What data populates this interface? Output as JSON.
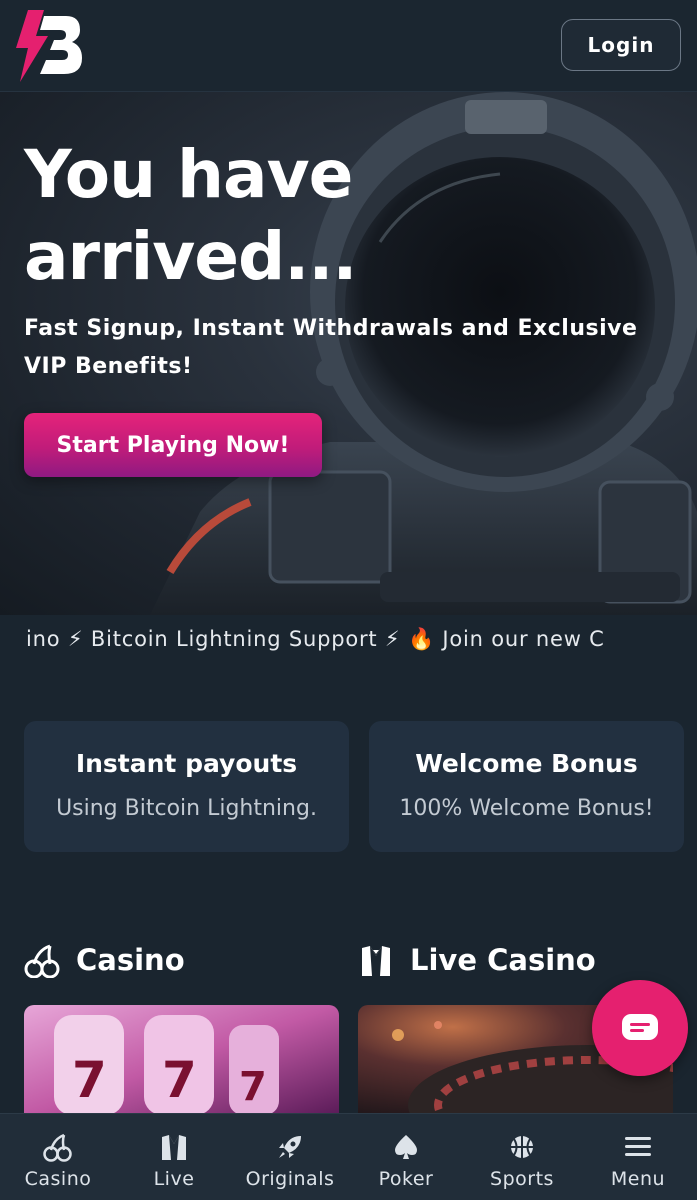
{
  "header": {
    "logo_name": "bolt-b-logo",
    "login_label": "Login"
  },
  "hero": {
    "title": "You have arrived...",
    "subtitle": "Fast Signup, Instant Withdrawals and Exclusive VIP Benefits!",
    "cta_label": "Start Playing Now!"
  },
  "ticker": {
    "text": "ino ⚡ Bitcoin Lightning Support ⚡ 🔥 Join our new C"
  },
  "features": [
    {
      "title": "Instant payouts",
      "subtitle": "Using Bitcoin Lightning."
    },
    {
      "title": "Welcome Bonus",
      "subtitle": "100% Welcome Bonus!"
    }
  ],
  "sections": {
    "casino": {
      "title": "Casino",
      "icon": "cherries-icon"
    },
    "live": {
      "title": "Live Casino",
      "icon": "tuxedo-icon"
    }
  },
  "chat": {
    "icon": "chat-icon"
  },
  "bottom_nav": [
    {
      "label": "Casino",
      "icon": "cherries-icon"
    },
    {
      "label": "Live",
      "icon": "tuxedo-icon"
    },
    {
      "label": "Originals",
      "icon": "rocket-icon"
    },
    {
      "label": "Poker",
      "icon": "spade-icon"
    },
    {
      "label": "Sports",
      "icon": "basketball-icon"
    },
    {
      "label": "Menu",
      "icon": "hamburger-icon"
    }
  ],
  "colors": {
    "background": "#1a252f",
    "accent_pink": "#e5206f",
    "card_bg": "#223040",
    "nav_bg": "#212d39"
  }
}
